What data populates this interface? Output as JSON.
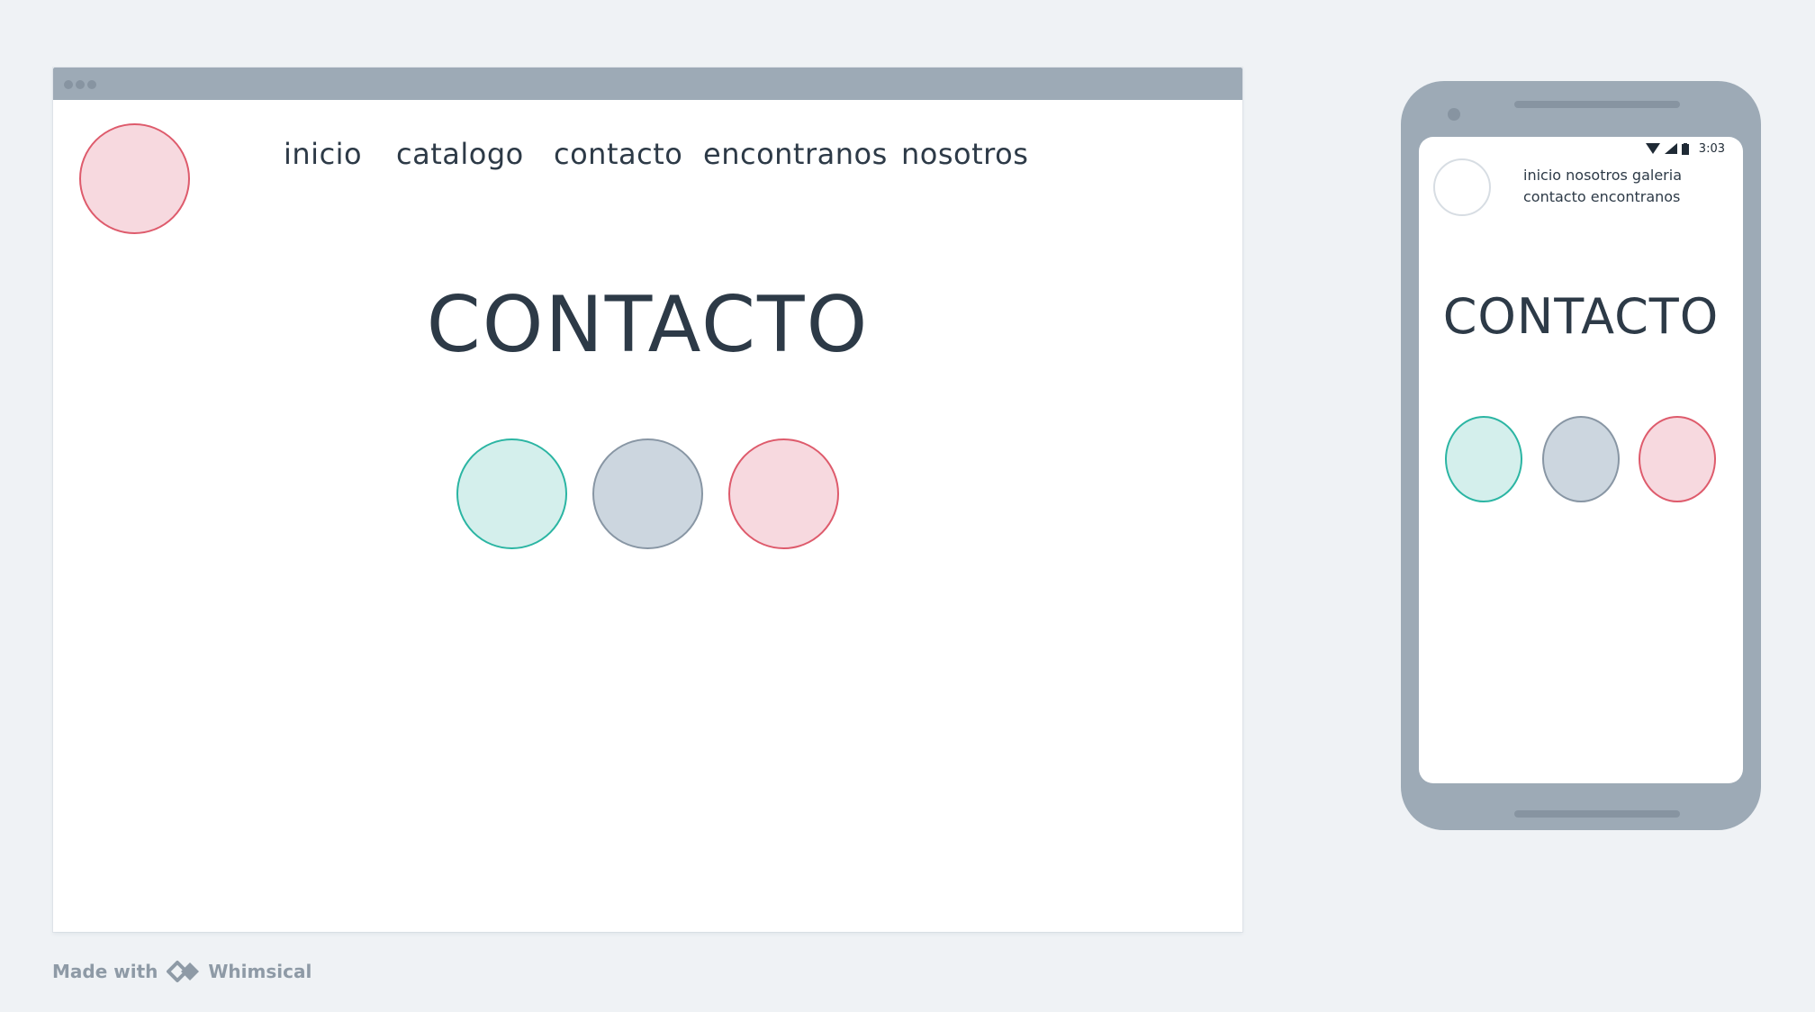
{
  "desktop": {
    "nav": [
      "inicio",
      "catalogo",
      "contacto",
      "encontranos",
      "nosotros"
    ],
    "title": "CONTACTO"
  },
  "mobile": {
    "status": {
      "time": "3:03"
    },
    "nav_lines": [
      "inicio nosotros galeria",
      "contacto encontranos"
    ],
    "title": "CONTACTO"
  },
  "footer": {
    "made_with": "Made with",
    "brand": "Whimsical"
  },
  "colors": {
    "pink_fill": "#f7d9df",
    "pink_stroke": "#de5b6c",
    "teal_fill": "#d4efec",
    "teal_stroke": "#2bb5a3",
    "gray_fill": "#ccd6df",
    "gray_stroke": "#8896a4",
    "frame": "#9daab6",
    "text": "#2d3a47"
  },
  "icons": [
    "wifi-icon",
    "signal-icon",
    "battery-icon",
    "whimsical-logo-icon"
  ]
}
